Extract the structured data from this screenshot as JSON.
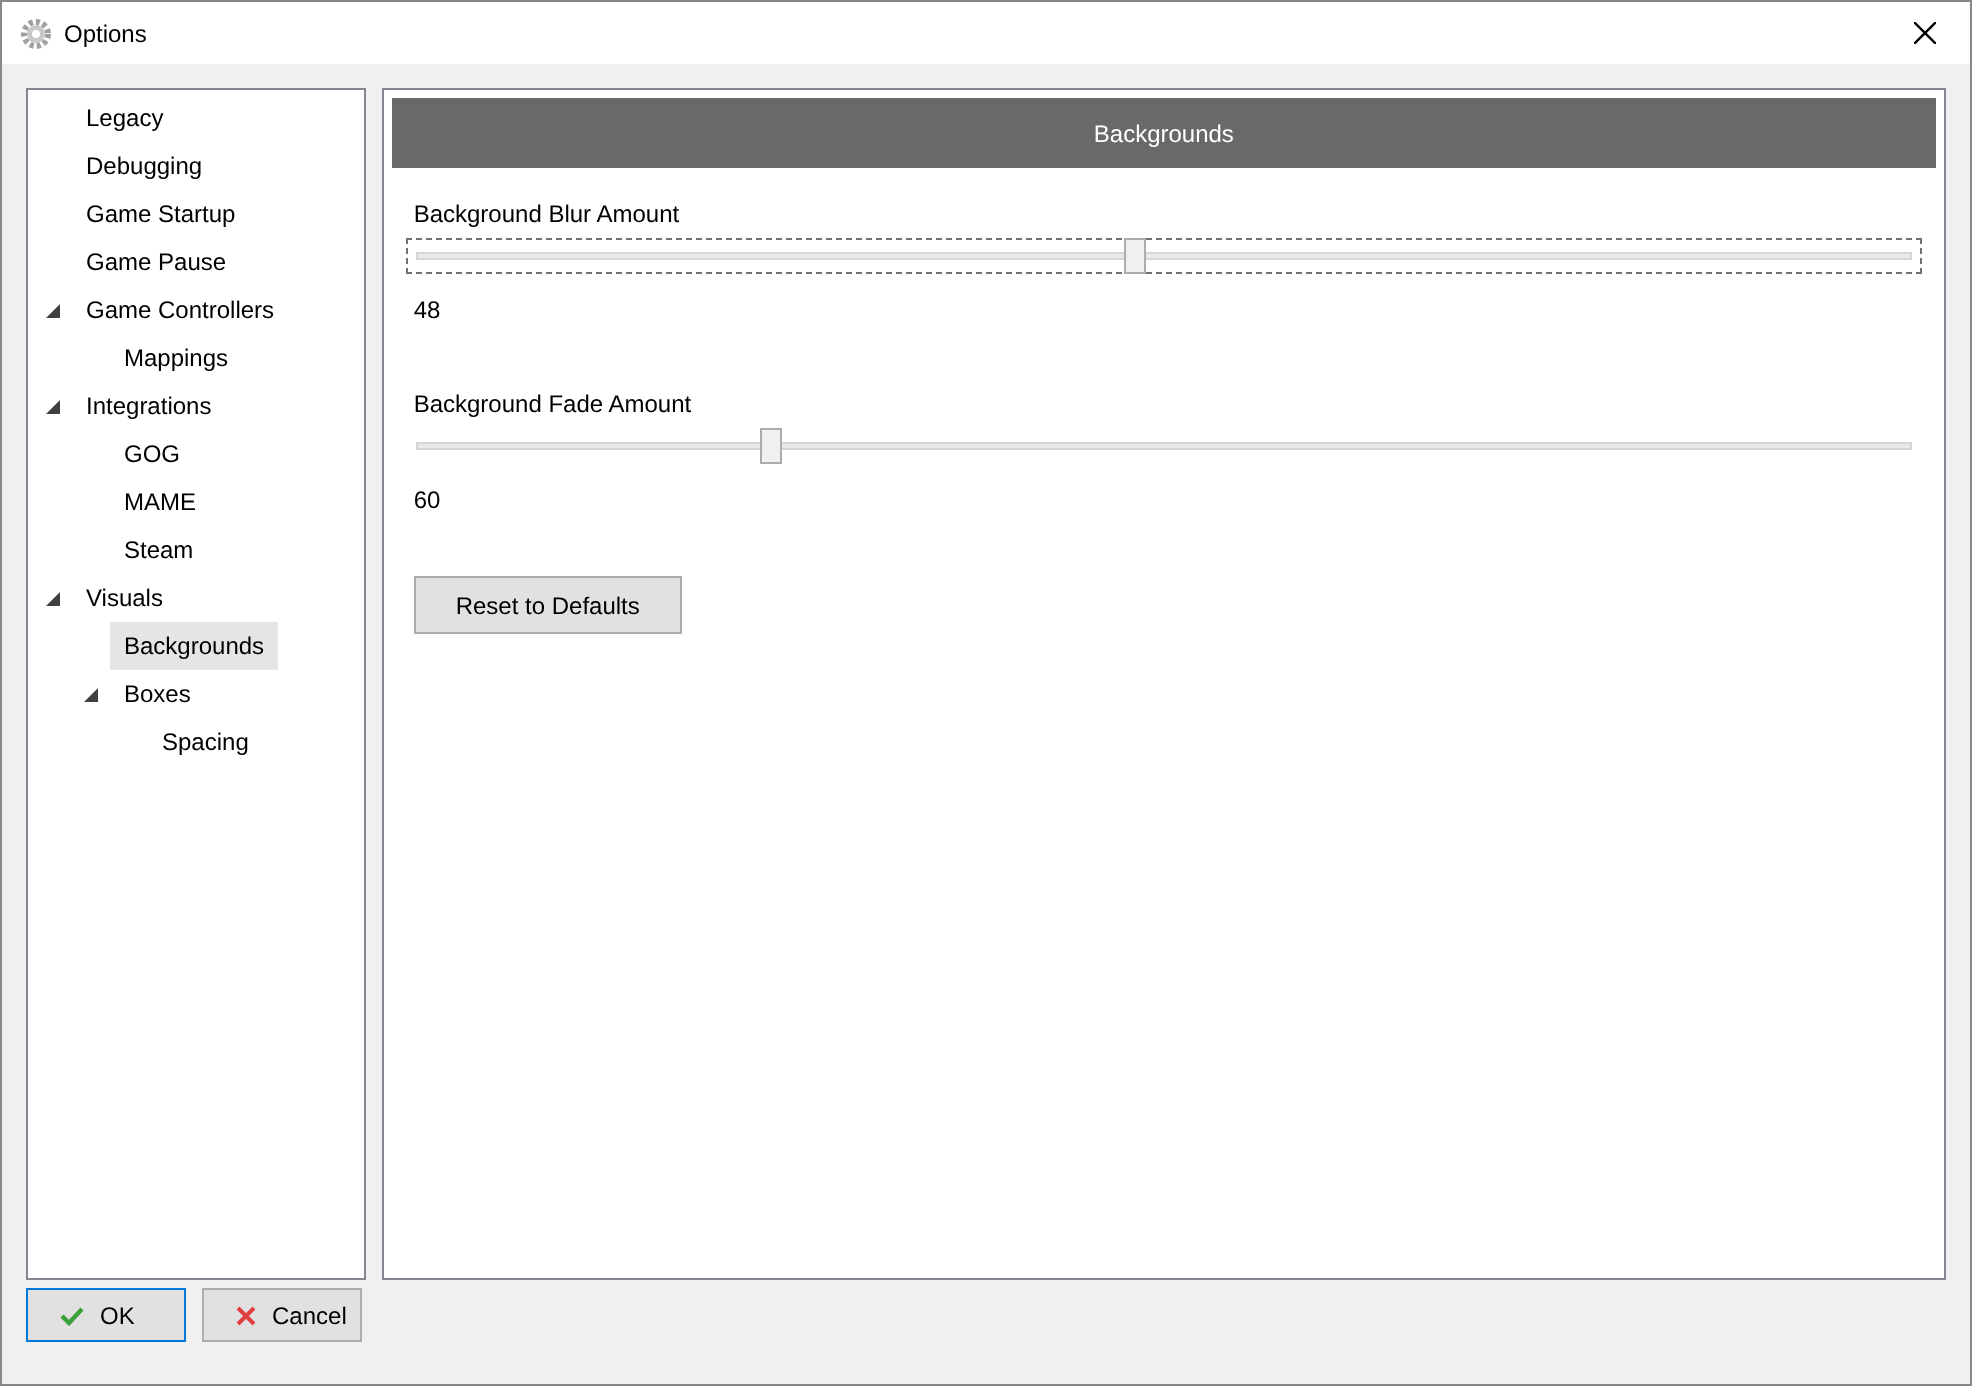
{
  "window": {
    "title": "Options"
  },
  "tree": [
    {
      "label": "Legacy",
      "selected": false
    },
    {
      "label": "Debugging",
      "selected": false
    },
    {
      "label": "Game Startup",
      "selected": false
    },
    {
      "label": "Game Pause",
      "selected": false
    },
    {
      "label": "Game Controllers",
      "selected": false,
      "expanded": true,
      "children": [
        {
          "label": "Mappings",
          "selected": false
        }
      ]
    },
    {
      "label": "Integrations",
      "selected": false,
      "expanded": true,
      "children": [
        {
          "label": "GOG",
          "selected": false
        },
        {
          "label": "MAME",
          "selected": false
        },
        {
          "label": "Steam",
          "selected": false
        }
      ]
    },
    {
      "label": "Visuals",
      "selected": false,
      "expanded": true,
      "children": [
        {
          "label": "Backgrounds",
          "selected": true
        },
        {
          "label": "Boxes",
          "selected": false,
          "expanded": true,
          "children": [
            {
              "label": "Spacing",
              "selected": false
            }
          ]
        }
      ]
    }
  ],
  "panel": {
    "title": "Backgrounds",
    "sliders": [
      {
        "label": "Background Blur Amount",
        "level": 0.48,
        "reading": "48",
        "focused": true
      },
      {
        "label": "Background Fade Amount",
        "level": 0.236,
        "reading": "60",
        "focused": false
      }
    ],
    "reset_button": "Reset to Defaults"
  },
  "buttons": [
    {
      "kind": "ok",
      "label": "OK",
      "focused": true
    },
    {
      "kind": "cancel",
      "label": "Cancel",
      "focused": false
    }
  ]
}
